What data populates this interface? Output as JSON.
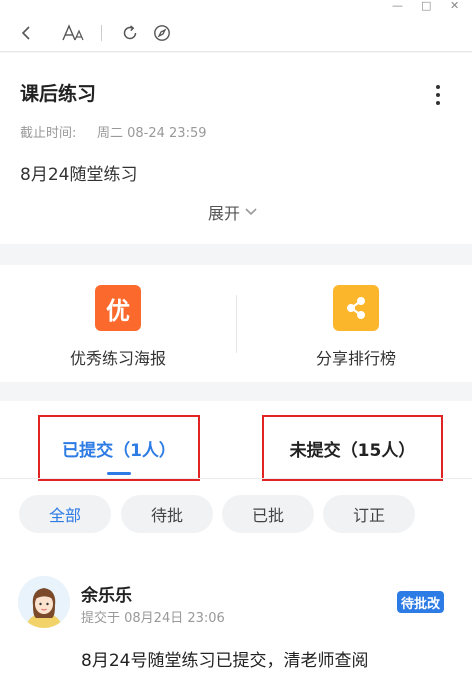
{
  "window": {
    "minimize": "—",
    "maximize": "□",
    "close": "✕"
  },
  "toolbar": {
    "back_icon": "chevron-left-icon",
    "font_icon": "font-size-icon",
    "refresh_icon": "refresh-icon",
    "compass_icon": "compass-icon"
  },
  "assignment": {
    "title": "课后练习",
    "deadline_label": "截止时间:",
    "deadline_value": "周二 08-24 23:59",
    "description": "8月24随堂练习",
    "expand_label": "展开"
  },
  "features": [
    {
      "icon_text": "优",
      "label": "优秀练习海报",
      "color": "#fb6a2c"
    },
    {
      "label": "分享排行榜",
      "color": "#fbb62c"
    }
  ],
  "tabs": [
    {
      "label": "已提交（1人）",
      "active": true
    },
    {
      "label": "未提交（15人）",
      "active": false
    }
  ],
  "filters": [
    "全部",
    "待批",
    "已批",
    "订正"
  ],
  "submission": {
    "name": "余乐乐",
    "time": "提交于 08月24日 23:06",
    "status": "待批改",
    "message": "8月24号随堂练习已提交，清老师查阅"
  },
  "colors": {
    "accent": "#2d7be5",
    "highlight_border": "#e02424"
  }
}
